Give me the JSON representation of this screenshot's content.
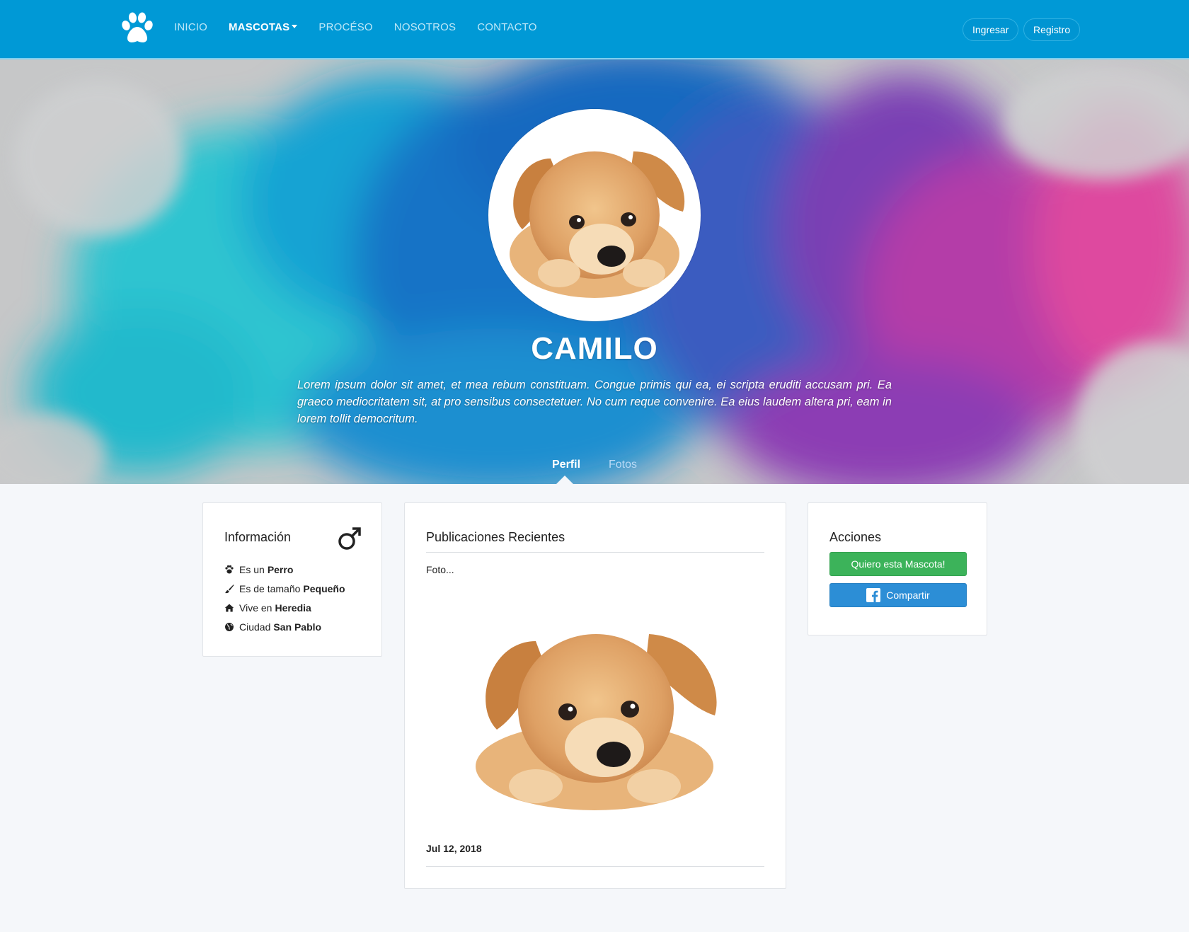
{
  "nav": {
    "links": [
      "INICIO",
      "MASCOTAS",
      "PROCÉSO",
      "NOSOTROS",
      "CONTACTO"
    ],
    "active": "MASCOTAS",
    "login_label": "Ingresar",
    "register_label": "Registro"
  },
  "hero": {
    "name": "CAMILO",
    "description": "Lorem ipsum dolor sit amet, et mea rebum constituam. Congue primis qui ea, ei scripta eruditi accusam pri. Ea graeco mediocritatem sit, at pro sensibus consectetuer. No cum reque convenire. Ea eius laudem altera pri, eam in lorem tollit democritum.",
    "tabs": [
      "Perfil",
      "Fotos"
    ],
    "active_tab": "Perfil"
  },
  "info": {
    "title": "Información",
    "gender_icon": "male-symbol-icon",
    "items": [
      {
        "icon": "paw-icon",
        "label": "Es un",
        "value": "Perro"
      },
      {
        "icon": "brush-icon",
        "label": "Es de tamaño",
        "value": "Pequeño"
      },
      {
        "icon": "home-icon",
        "label": "Vive en",
        "value": "Heredia"
      },
      {
        "icon": "globe-icon",
        "label": "Ciudad",
        "value": "San Pablo"
      }
    ]
  },
  "posts": {
    "title": "Publicaciones Recientes",
    "items": [
      {
        "caption": "Foto...",
        "date": "Jul 12, 2018"
      }
    ]
  },
  "actions": {
    "title": "Acciones",
    "adopt_label": "Quiero esta Mascota!",
    "share_label": "Compartir"
  },
  "colors": {
    "navbar": "#0099d6",
    "adopt_button": "#3cb35a",
    "share_button": "#2c8ed6"
  }
}
